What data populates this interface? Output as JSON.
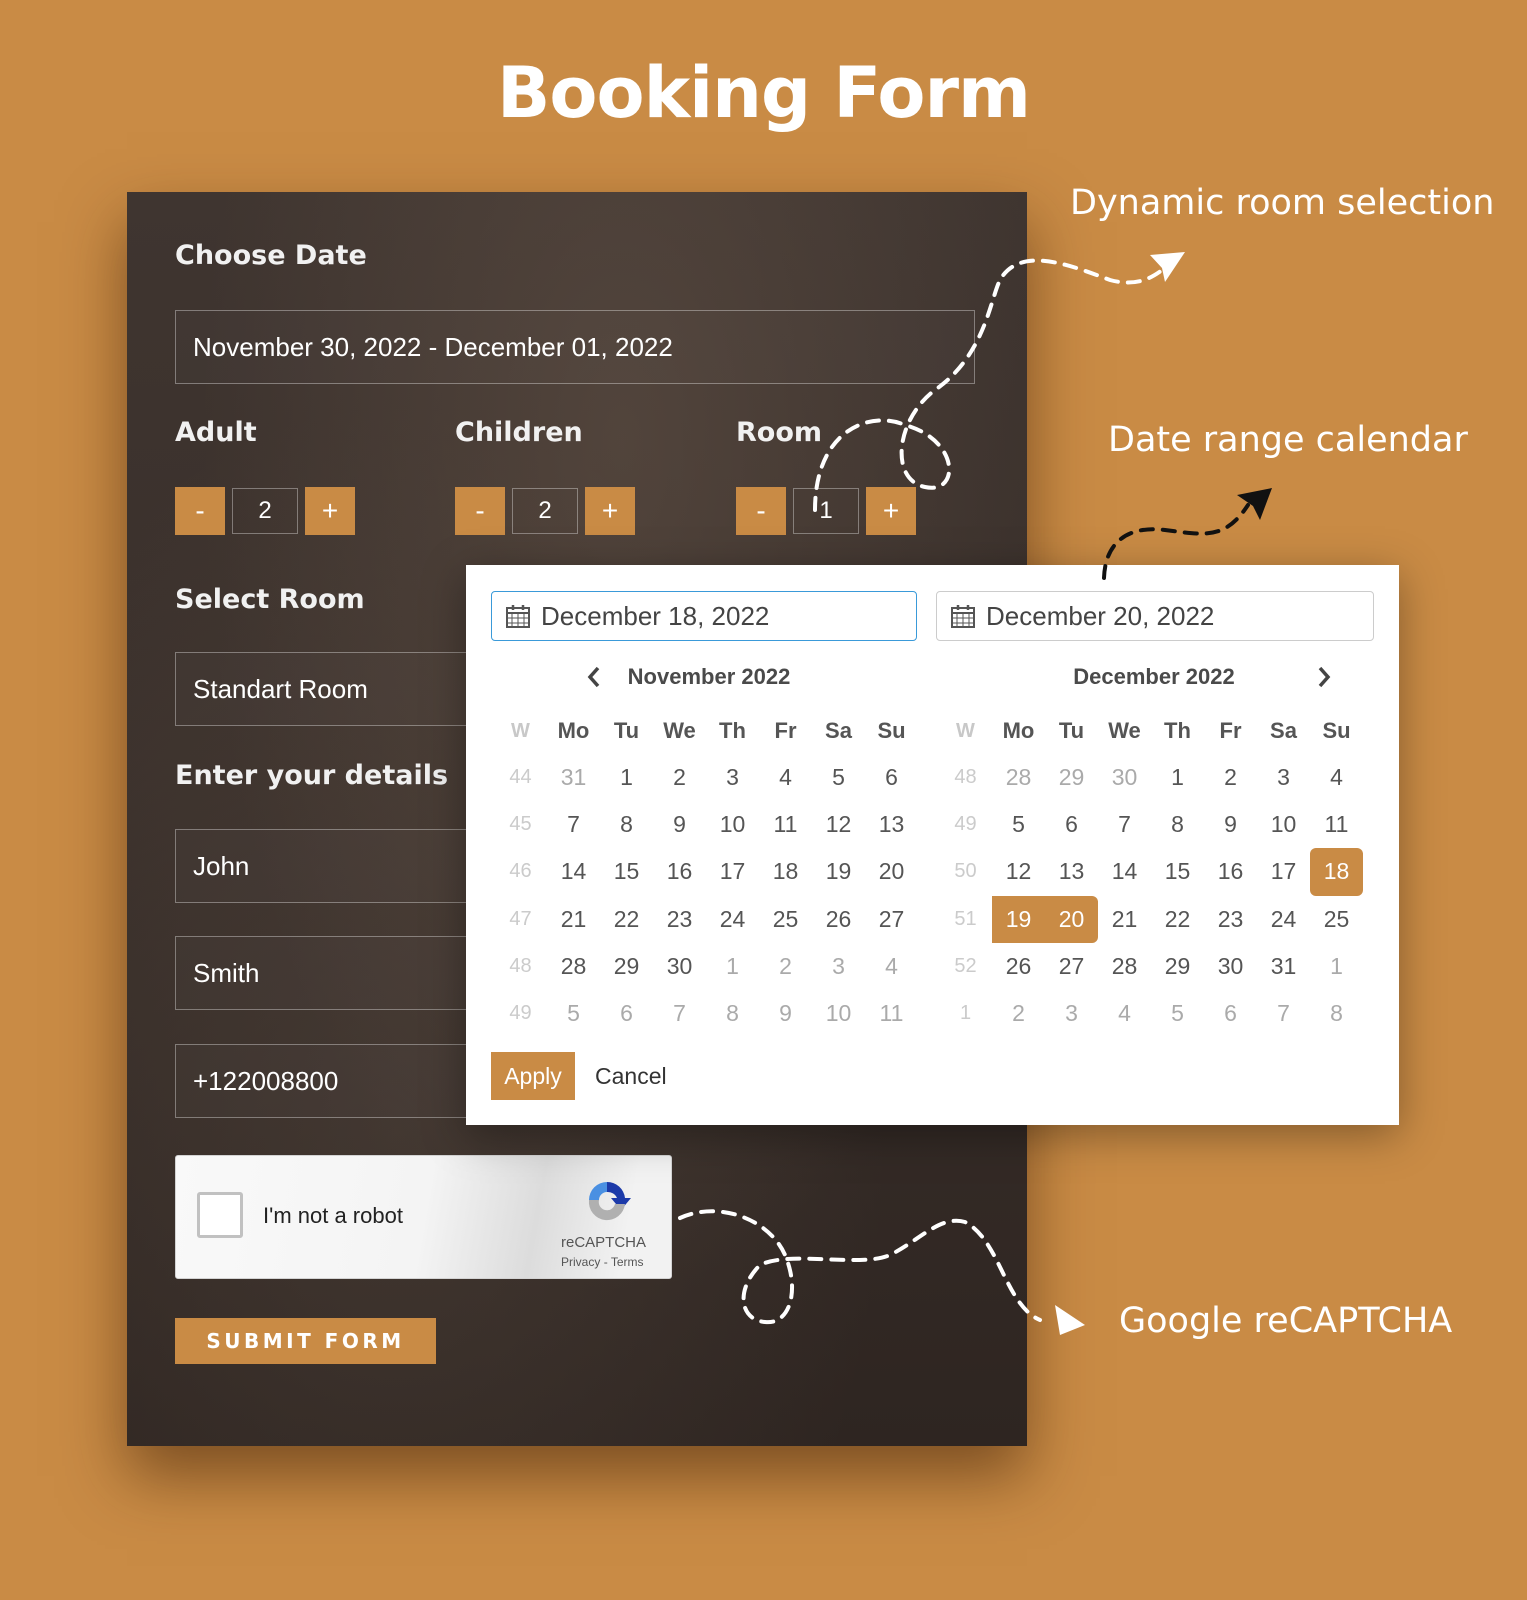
{
  "page_title": "Booking Form",
  "colors": {
    "accent": "#c98b45",
    "panel": "#3a302b",
    "focus": "#3a9ad9"
  },
  "form": {
    "choose_date_label": "Choose Date",
    "date_range_value": "November 30, 2022 - December 01, 2022",
    "adult": {
      "label": "Adult",
      "minus": "-",
      "plus": "+",
      "value": "2"
    },
    "children": {
      "label": "Children",
      "minus": "-",
      "plus": "+",
      "value": "2"
    },
    "room": {
      "label": "Room",
      "minus": "-",
      "plus": "+",
      "value": "1"
    },
    "select_room_label": "Select Room",
    "room_value": "Standart Room",
    "details_label": "Enter your details",
    "first_name": "John",
    "last_name": "Smith",
    "phone": "+122008800",
    "recaptcha": {
      "label": "I'm not a robot",
      "brand": "reCAPTCHA",
      "privacy": "Privacy",
      "separator": "-",
      "terms": "Terms"
    },
    "submit_label": "SUBMIT FORM"
  },
  "calendar": {
    "start_input": "December 18, 2022",
    "end_input": "December 20, 2022",
    "icon": "calendar-icon",
    "apply_label": "Apply",
    "cancel_label": "Cancel",
    "weekday_headers": [
      "W",
      "Mo",
      "Tu",
      "We",
      "Th",
      "Fr",
      "Sa",
      "Su"
    ],
    "months": [
      {
        "title": "November 2022",
        "nav": "prev",
        "weeks": [
          {
            "wk": "44",
            "days": [
              {
                "d": "31",
                "off": true
              },
              {
                "d": "1"
              },
              {
                "d": "2"
              },
              {
                "d": "3"
              },
              {
                "d": "4"
              },
              {
                "d": "5"
              },
              {
                "d": "6"
              }
            ]
          },
          {
            "wk": "45",
            "days": [
              {
                "d": "7"
              },
              {
                "d": "8"
              },
              {
                "d": "9"
              },
              {
                "d": "10"
              },
              {
                "d": "11"
              },
              {
                "d": "12"
              },
              {
                "d": "13"
              }
            ]
          },
          {
            "wk": "46",
            "days": [
              {
                "d": "14"
              },
              {
                "d": "15"
              },
              {
                "d": "16"
              },
              {
                "d": "17"
              },
              {
                "d": "18"
              },
              {
                "d": "19"
              },
              {
                "d": "20"
              }
            ]
          },
          {
            "wk": "47",
            "days": [
              {
                "d": "21"
              },
              {
                "d": "22"
              },
              {
                "d": "23"
              },
              {
                "d": "24"
              },
              {
                "d": "25"
              },
              {
                "d": "26"
              },
              {
                "d": "27"
              }
            ]
          },
          {
            "wk": "48",
            "days": [
              {
                "d": "28"
              },
              {
                "d": "29"
              },
              {
                "d": "30"
              },
              {
                "d": "1",
                "off": true
              },
              {
                "d": "2",
                "off": true
              },
              {
                "d": "3",
                "off": true
              },
              {
                "d": "4",
                "off": true
              }
            ]
          },
          {
            "wk": "49",
            "days": [
              {
                "d": "5",
                "off": true
              },
              {
                "d": "6",
                "off": true
              },
              {
                "d": "7",
                "off": true
              },
              {
                "d": "8",
                "off": true
              },
              {
                "d": "9",
                "off": true
              },
              {
                "d": "10",
                "off": true
              },
              {
                "d": "11",
                "off": true
              }
            ]
          }
        ]
      },
      {
        "title": "December 2022",
        "nav": "next",
        "weeks": [
          {
            "wk": "48",
            "days": [
              {
                "d": "28",
                "off": true
              },
              {
                "d": "29",
                "off": true
              },
              {
                "d": "30",
                "off": true
              },
              {
                "d": "1"
              },
              {
                "d": "2"
              },
              {
                "d": "3"
              },
              {
                "d": "4"
              }
            ]
          },
          {
            "wk": "49",
            "days": [
              {
                "d": "5"
              },
              {
                "d": "6"
              },
              {
                "d": "7"
              },
              {
                "d": "8"
              },
              {
                "d": "9"
              },
              {
                "d": "10"
              },
              {
                "d": "11"
              }
            ]
          },
          {
            "wk": "50",
            "days": [
              {
                "d": "12"
              },
              {
                "d": "13"
              },
              {
                "d": "14"
              },
              {
                "d": "15"
              },
              {
                "d": "16"
              },
              {
                "d": "17"
              },
              {
                "d": "18",
                "sel": "start"
              }
            ]
          },
          {
            "wk": "51",
            "days": [
              {
                "d": "19",
                "sel": "range"
              },
              {
                "d": "20",
                "sel": "end"
              },
              {
                "d": "21"
              },
              {
                "d": "22"
              },
              {
                "d": "23"
              },
              {
                "d": "24"
              },
              {
                "d": "25"
              }
            ]
          },
          {
            "wk": "52",
            "days": [
              {
                "d": "26"
              },
              {
                "d": "27"
              },
              {
                "d": "28"
              },
              {
                "d": "29"
              },
              {
                "d": "30"
              },
              {
                "d": "31"
              },
              {
                "d": "1",
                "off": true
              }
            ]
          },
          {
            "wk": "1",
            "days": [
              {
                "d": "2",
                "off": true
              },
              {
                "d": "3",
                "off": true
              },
              {
                "d": "4",
                "off": true
              },
              {
                "d": "5",
                "off": true
              },
              {
                "d": "6",
                "off": true
              },
              {
                "d": "7",
                "off": true
              },
              {
                "d": "8",
                "off": true
              }
            ]
          }
        ]
      }
    ]
  },
  "annotations": {
    "room_selection": "Dynamic room selection",
    "date_range": "Date range calendar",
    "recaptcha": "Google reCAPTCHA"
  }
}
